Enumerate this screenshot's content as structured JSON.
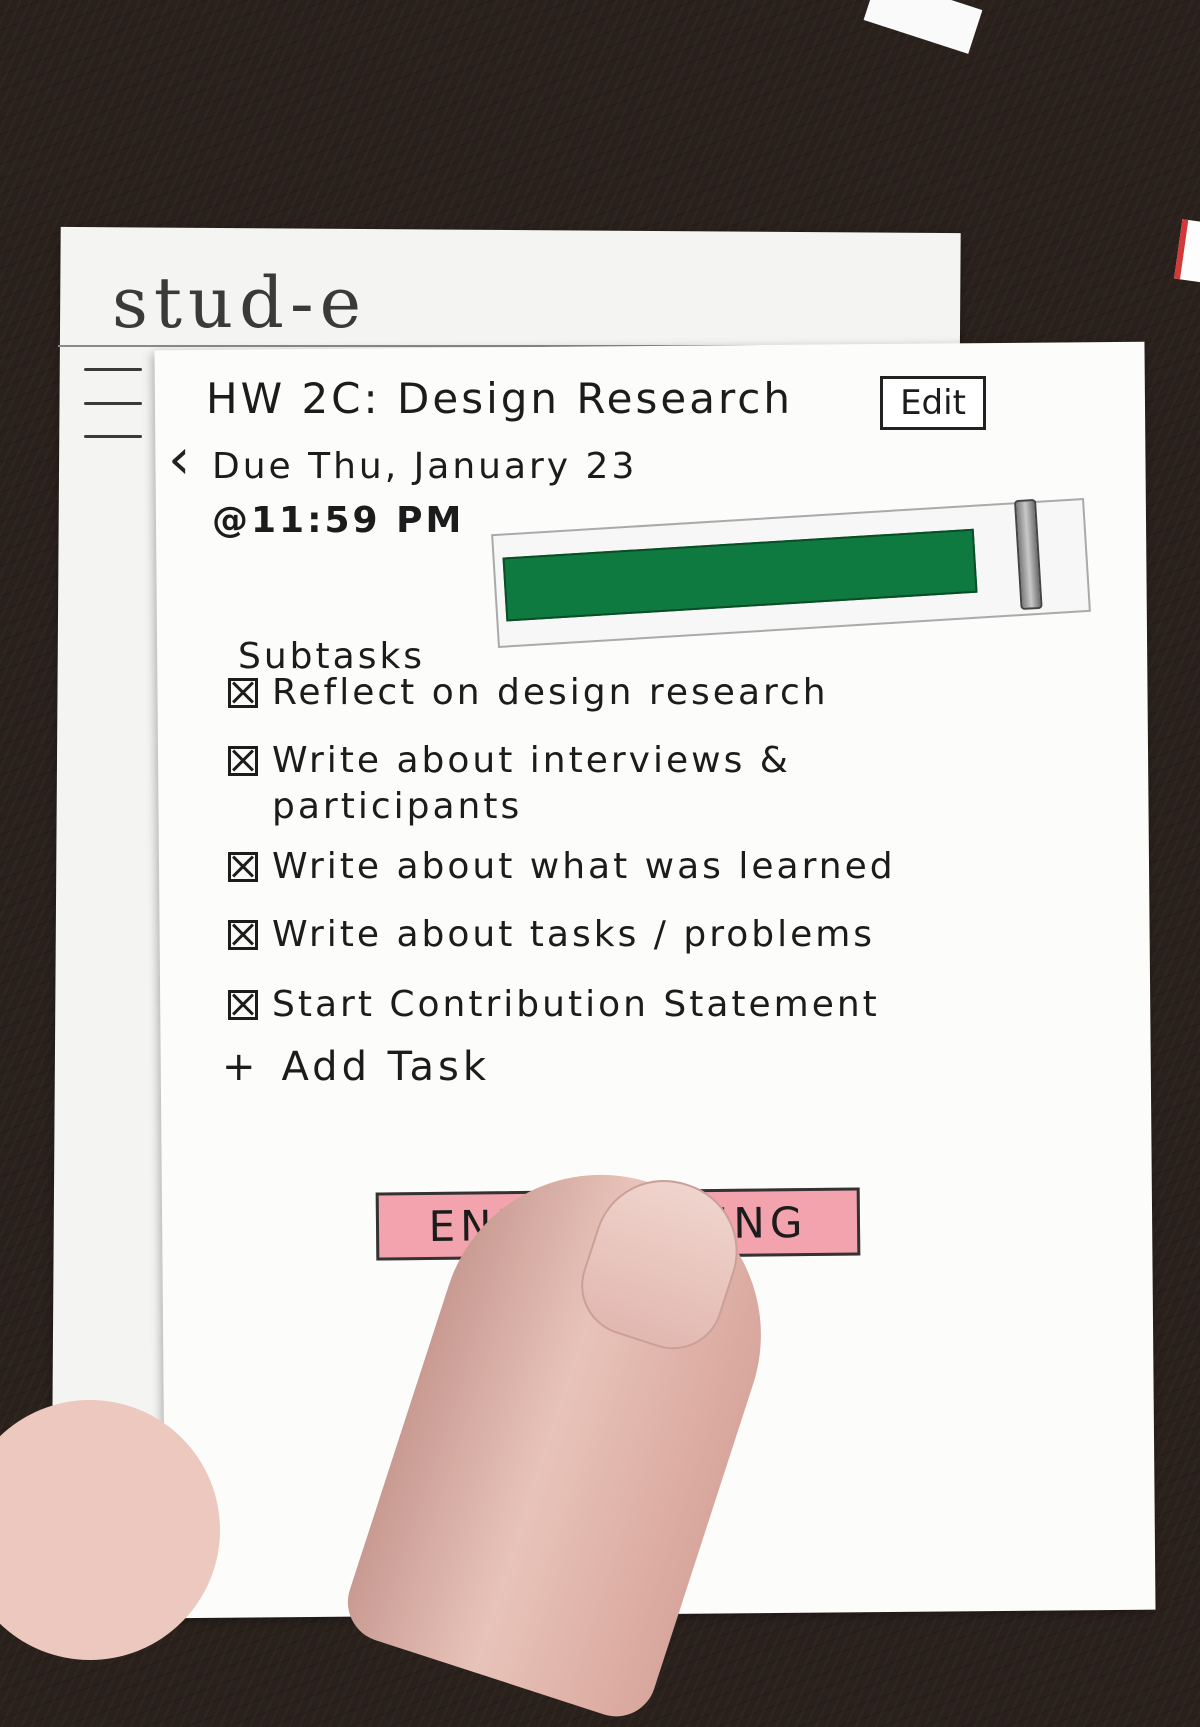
{
  "app": {
    "title": "stud-e"
  },
  "assignment": {
    "title": "HW 2C: Design Research",
    "edit_label": "Edit",
    "due_line": "Due Thu, January 23",
    "due_time": "@11:59 PM",
    "progress_fraction": 0.9
  },
  "subtasks": {
    "heading": "Subtasks",
    "items": [
      {
        "label": "Reflect on design research",
        "checked": true
      },
      {
        "label": "Write about interviews & participants",
        "checked": true
      },
      {
        "label": "Write about what was learned",
        "checked": true
      },
      {
        "label": "Write about tasks / problems",
        "checked": true
      },
      {
        "label": "Start Contribution Statement",
        "checked": true
      }
    ],
    "add_label": "Add Task",
    "add_icon": "+"
  },
  "end_button": {
    "label": "END STUDYING"
  },
  "icons": {
    "menu": "hamburger-icon",
    "back": "chevron-left-icon"
  },
  "colors": {
    "progress": "#0f7a3f",
    "end_button": "#f2a3ad"
  }
}
